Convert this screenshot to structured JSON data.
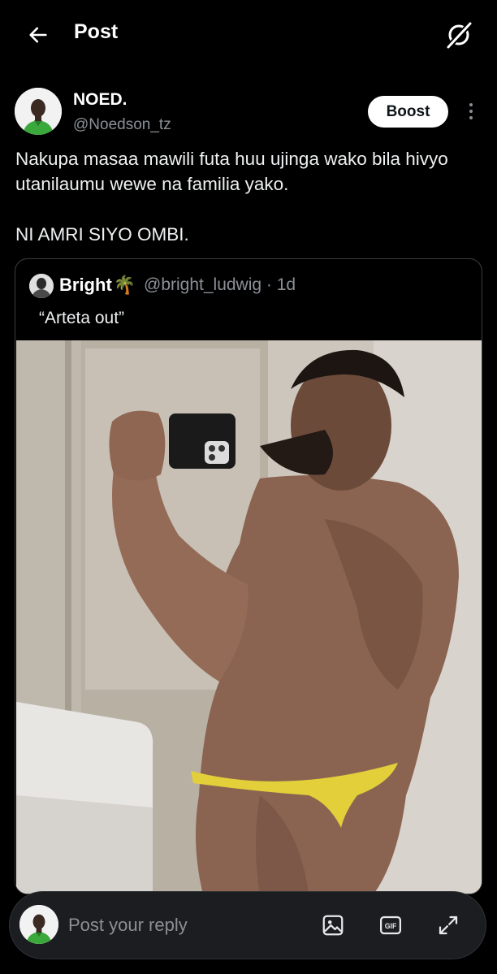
{
  "header": {
    "title": "Post",
    "back_icon": "arrow-left-icon",
    "grok_icon": "grok-icon"
  },
  "post": {
    "author_name": "NOED.",
    "author_handle": "@Noedson_tz",
    "boost_label": "Boost",
    "text_line1": "Nakupa masaa mawili futa huu ujinga wako bila hivyo utanilaumu wewe na familia yako.",
    "text_line2": "NI AMRI SIYO OMBI."
  },
  "quote": {
    "author_name": "Bright",
    "author_emoji": "🌴",
    "author_handle_time": "@bright_ludwig · 1d",
    "text": "“Arteta out”"
  },
  "reply": {
    "placeholder": "Post your reply",
    "icons": [
      "image-icon",
      "gif-icon",
      "expand-icon"
    ]
  },
  "colors": {
    "background": "#000000",
    "text": "#e7e9ea",
    "secondary_text": "#8b9096",
    "boost_bg": "#ffffff",
    "border": "#2f3336"
  }
}
